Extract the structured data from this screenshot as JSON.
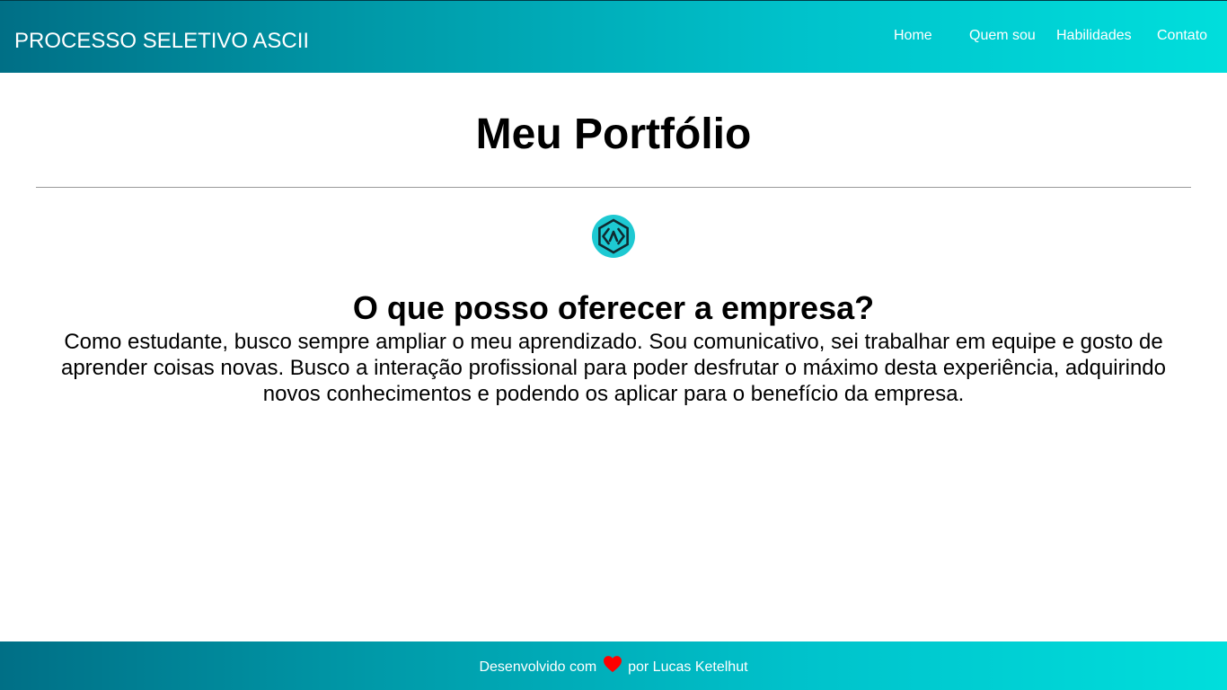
{
  "header": {
    "brand": "PROCESSO SELETIVO ASCII",
    "nav": {
      "home": "Home",
      "quem_sou": "Quem sou",
      "habilidades": "Habilidades",
      "contato": "Contato"
    }
  },
  "main": {
    "title": "Meu Portfólio",
    "logo_icon": "code-hexagon-icon",
    "section_title": "O que posso oferecer a empresa?",
    "section_text": "Como estudante, busco sempre ampliar o meu aprendizado. Sou comunicativo, sei trabalhar em equipe e gosto de aprender coisas novas. Busco a interação profissional para poder desfrutar o máximo desta experiência, adquirindo novos conhecimentos e podendo os aplicar para o benefício da empresa."
  },
  "footer": {
    "prefix": "Desenvolvido com",
    "heart_icon": "heart-icon",
    "suffix": "por Lucas Ketelhut"
  },
  "colors": {
    "gradient_start": "#006f86",
    "gradient_end": "#00dedc",
    "heart": "#ff0000",
    "logo_fill": "#1ec9d2"
  }
}
